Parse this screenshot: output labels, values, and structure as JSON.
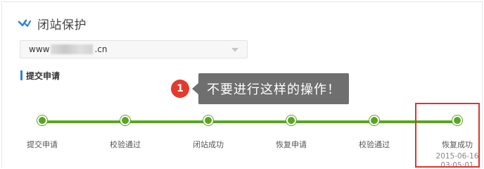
{
  "header": {
    "title": "闭站保护",
    "icon": "check-logo-icon",
    "icon_color": "#2a83d8"
  },
  "domain_select": {
    "prefix": "www",
    "suffix": ".cn",
    "arrow_icon": "chevron-down-icon"
  },
  "section": {
    "title": "提交申请",
    "accent_color": "#2a83d8"
  },
  "warning": {
    "badge": "1",
    "text": "不要进行这样的操作！",
    "badge_color": "#e23b2e",
    "box_color": "#6f6f6f"
  },
  "timeline": {
    "line_color": "#5aa521",
    "steps": [
      {
        "label": "提交申请"
      },
      {
        "label": "校验通过"
      },
      {
        "label": "闭站成功"
      },
      {
        "label": "恢复申请"
      },
      {
        "label": "校验通过"
      },
      {
        "label": "恢复成功",
        "date": "2015-06-16",
        "time": "03:05:01"
      }
    ]
  },
  "highlight": {
    "color": "#e0332a"
  }
}
